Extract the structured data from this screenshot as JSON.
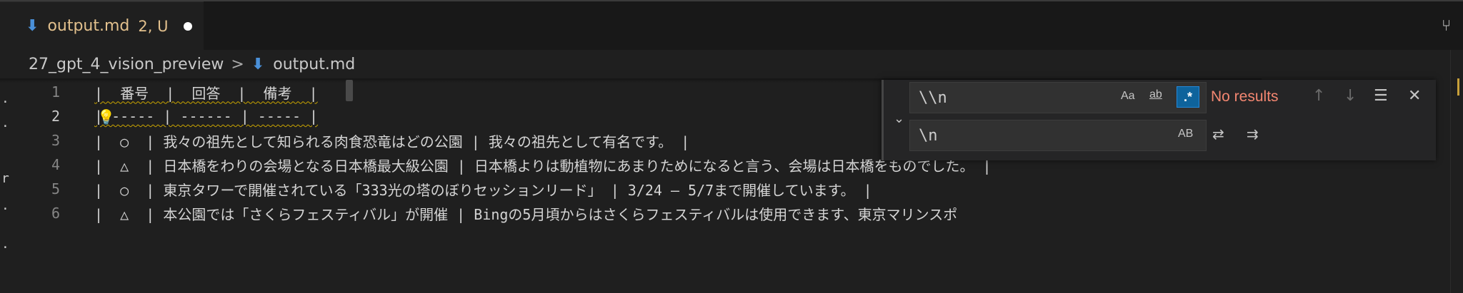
{
  "tab": {
    "icon": "markdown-arrow-icon",
    "filename": "output.md",
    "status": "2, U"
  },
  "breadcrumbs": {
    "folder": "27_gpt_4_vision_preview",
    "separator": ">",
    "file": "output.md"
  },
  "left_gutter_chars": [
    ".",
    ".",
    "r",
    ".",
    "."
  ],
  "editor": {
    "lines": [
      {
        "num": "1",
        "text": "|  番号  |  回答  |  備考  |"
      },
      {
        "num": "2",
        "text": "|------ | ------ | ----- |"
      },
      {
        "num": "3",
        "text": "|  ○  | 我々の祖先として知られる肉食恐竜はどの公園 | 我々の祖先として有名です。 |"
      },
      {
        "num": "4",
        "text": "|  △  | 日本橋をわりの会場となる日本橋最大級公園 | 日本橋よりは動植物にあまりためになると言う、会場は日本橋をものでした。 |"
      },
      {
        "num": "5",
        "text": "|  ○  | 東京タワーで開催されている「333光の塔のぼりセッションリード」 | 3/24 – 5/7まで開催しています。 |"
      },
      {
        "num": "6",
        "text": "|  △  | 本公園では「さくらフェスティバル」が開催 | Bingの5月頃からはさくらフェスティバルは使用できます、東京マリンスポ"
      }
    ]
  },
  "find_widget": {
    "find_value": "\\\\n",
    "replace_value": "\\n",
    "match_case_label": "Aa",
    "whole_word_label": "ab",
    "regex_label": ".*",
    "preserve_case_label": "AB",
    "status": "No results"
  }
}
